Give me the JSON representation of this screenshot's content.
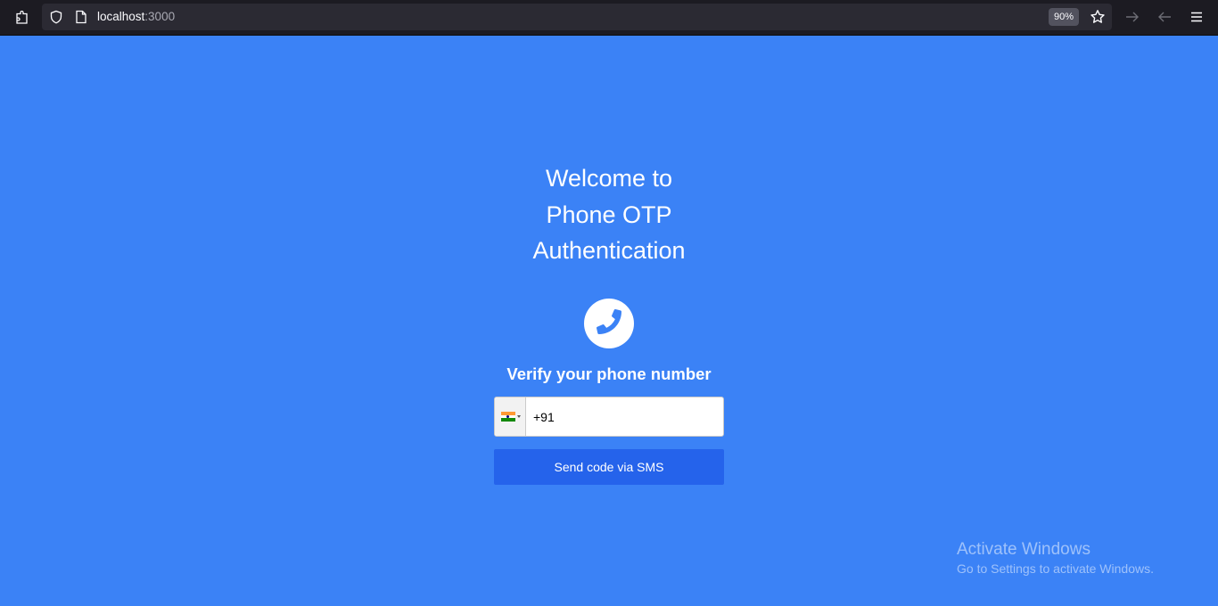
{
  "browser": {
    "url_host": "localhost",
    "url_port": ":3000",
    "zoom_level": "90%",
    "icons": [
      "extensions-icon",
      "shield-icon",
      "page-icon",
      "star-icon",
      "forward-icon",
      "back-icon",
      "menu-icon"
    ]
  },
  "page": {
    "background_color": "#3b82f6",
    "heading_lines": [
      "Welcome to",
      "Phone OTP",
      "Authentication"
    ],
    "verify_label": "Verify your phone number",
    "phone_value": "+91",
    "country_flag": "India",
    "send_button_label": "Send code via SMS",
    "button_color": "#2563eb"
  },
  "watermark": {
    "title": "Activate Windows",
    "subtitle": "Go to Settings to activate Windows."
  }
}
